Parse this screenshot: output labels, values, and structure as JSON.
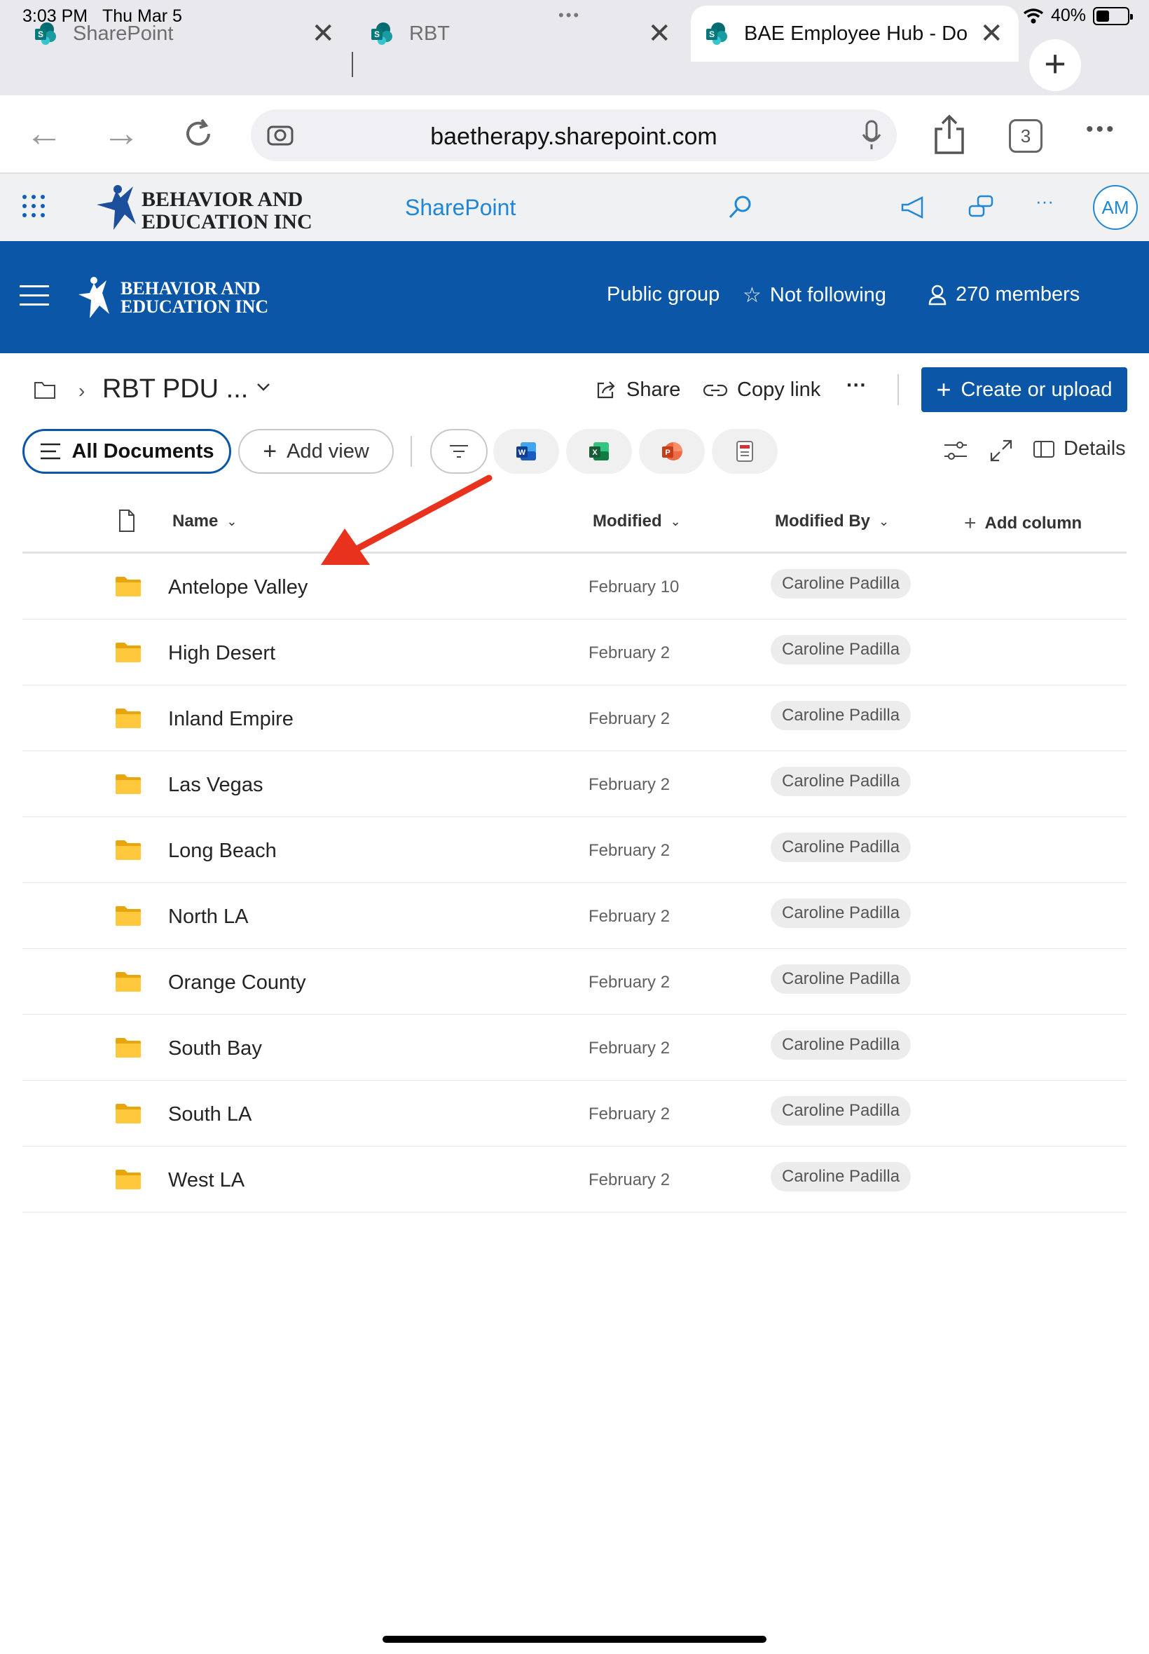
{
  "status": {
    "time": "3:03 PM",
    "date": "Thu Mar 5",
    "battery": "40%",
    "battery_level": 0.4
  },
  "tabs": [
    {
      "title": "SharePoint"
    },
    {
      "title": "RBT"
    },
    {
      "title": "BAE Employee Hub - Do"
    }
  ],
  "address": {
    "url": "baetherapy.sharepoint.com",
    "tab_count": "3"
  },
  "suite": {
    "app_name": "SharePoint",
    "avatar_initials": "AM",
    "brand_lines": [
      "BEHAVIOR AND",
      "EDUCATION INC"
    ]
  },
  "site": {
    "group_type": "Public group",
    "follow_label": "Not following",
    "members_label": "270 members"
  },
  "commands": {
    "library_title": "RBT PDU ...",
    "share": "Share",
    "copy_link": "Copy link",
    "more": "···",
    "create_upload": "Create or upload"
  },
  "views": {
    "all_documents": "All Documents",
    "add_view": "Add view",
    "details": "Details"
  },
  "columns": {
    "name": "Name",
    "modified": "Modified",
    "modified_by": "Modified By",
    "add_column": "Add column"
  },
  "rows": [
    {
      "name": "Antelope Valley",
      "modified": "February 10",
      "modified_by": "Caroline Padilla"
    },
    {
      "name": "High Desert",
      "modified": "February 2",
      "modified_by": "Caroline Padilla"
    },
    {
      "name": "Inland Empire",
      "modified": "February 2",
      "modified_by": "Caroline Padilla"
    },
    {
      "name": "Las Vegas",
      "modified": "February 2",
      "modified_by": "Caroline Padilla"
    },
    {
      "name": "Long Beach",
      "modified": "February 2",
      "modified_by": "Caroline Padilla"
    },
    {
      "name": "North LA",
      "modified": "February 2",
      "modified_by": "Caroline Padilla"
    },
    {
      "name": "Orange County",
      "modified": "February 2",
      "modified_by": "Caroline Padilla"
    },
    {
      "name": "South Bay",
      "modified": "February 2",
      "modified_by": "Caroline Padilla"
    },
    {
      "name": "South LA",
      "modified": "February 2",
      "modified_by": "Caroline Padilla"
    },
    {
      "name": "West LA",
      "modified": "February 2",
      "modified_by": "Caroline Padilla"
    }
  ],
  "colors": {
    "brand_blue": "#0b56a6",
    "sharepoint_blue": "#1f87d6",
    "folder_yellow": "#ffc83d",
    "annotation_red": "#e8321e"
  },
  "icons": {
    "tab": "sharepoint-icon",
    "folder": "folder-icon",
    "arrow": "red-arrow-annotation"
  }
}
